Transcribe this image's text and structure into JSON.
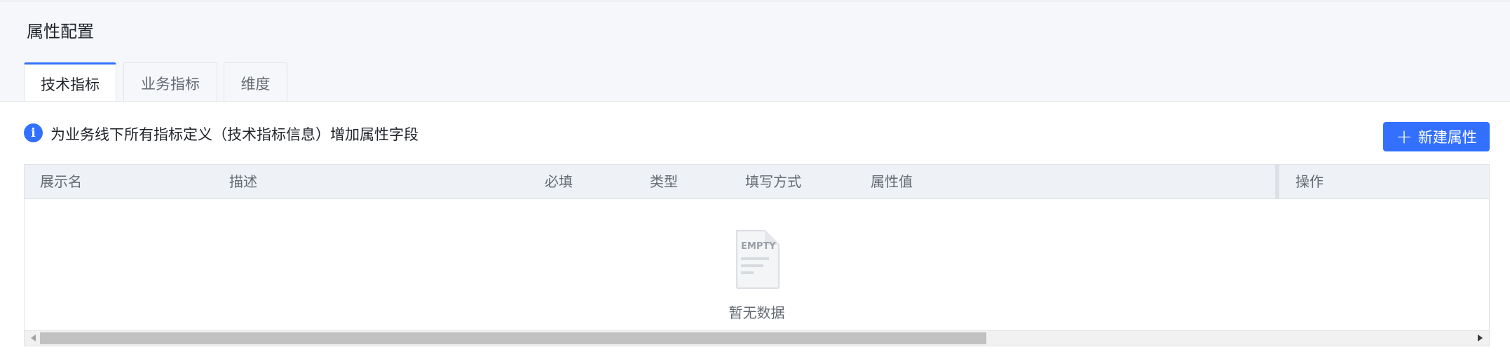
{
  "page": {
    "title": "属性配置"
  },
  "tabs": [
    {
      "label": "技术指标",
      "active": true
    },
    {
      "label": "业务指标",
      "active": false
    },
    {
      "label": "维度",
      "active": false
    }
  ],
  "info": {
    "icon": "info-icon",
    "text": "为业务线下所有指标定义（技术指标信息）增加属性字段"
  },
  "actions": {
    "new_button_label": "新建属性",
    "new_button_icon": "plus-icon"
  },
  "table": {
    "columns": [
      "展示名",
      "描述",
      "必填",
      "类型",
      "填写方式",
      "属性值",
      "操作"
    ],
    "rows": [],
    "empty": {
      "illustration_text": "EMPTY",
      "text": "暂无数据",
      "icon": "empty-document-icon"
    },
    "scroll_position": 0.0,
    "visible_fraction": 0.66
  },
  "colors": {
    "accent": "#3370ff",
    "header_bg": "#f6f7fa",
    "table_header_bg": "#eef1f5"
  }
}
